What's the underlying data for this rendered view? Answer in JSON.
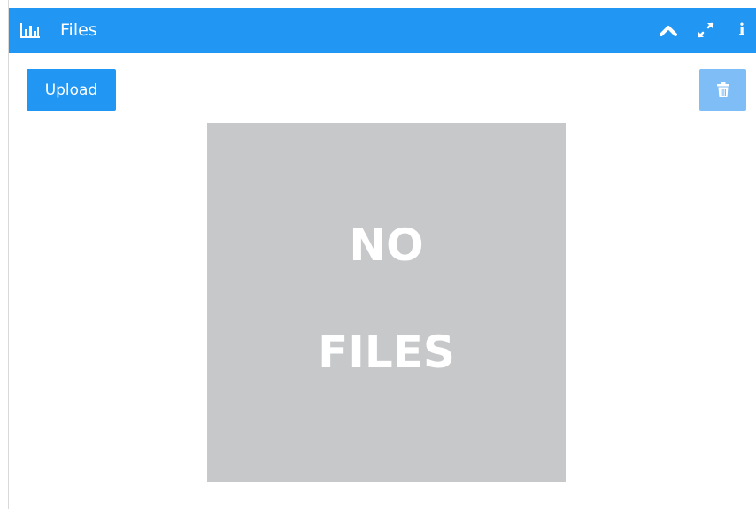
{
  "header": {
    "title": "Files",
    "icon": "bar-chart-icon",
    "actions": [
      {
        "name": "collapse",
        "icon": "chevron-up-icon"
      },
      {
        "name": "expand",
        "icon": "expand-arrows-icon"
      },
      {
        "name": "info",
        "icon": "info-icon",
        "glyph": "i"
      }
    ]
  },
  "toolbar": {
    "upload_label": "Upload",
    "delete_icon": "trash-icon"
  },
  "placeholder": {
    "line1": "NO",
    "line2": "FILES"
  },
  "colors": {
    "primary": "#2196f3",
    "primary_light": "#7fbdf6",
    "placeholder_bg": "#c7c8c9",
    "text_on_primary": "#ffffff"
  }
}
